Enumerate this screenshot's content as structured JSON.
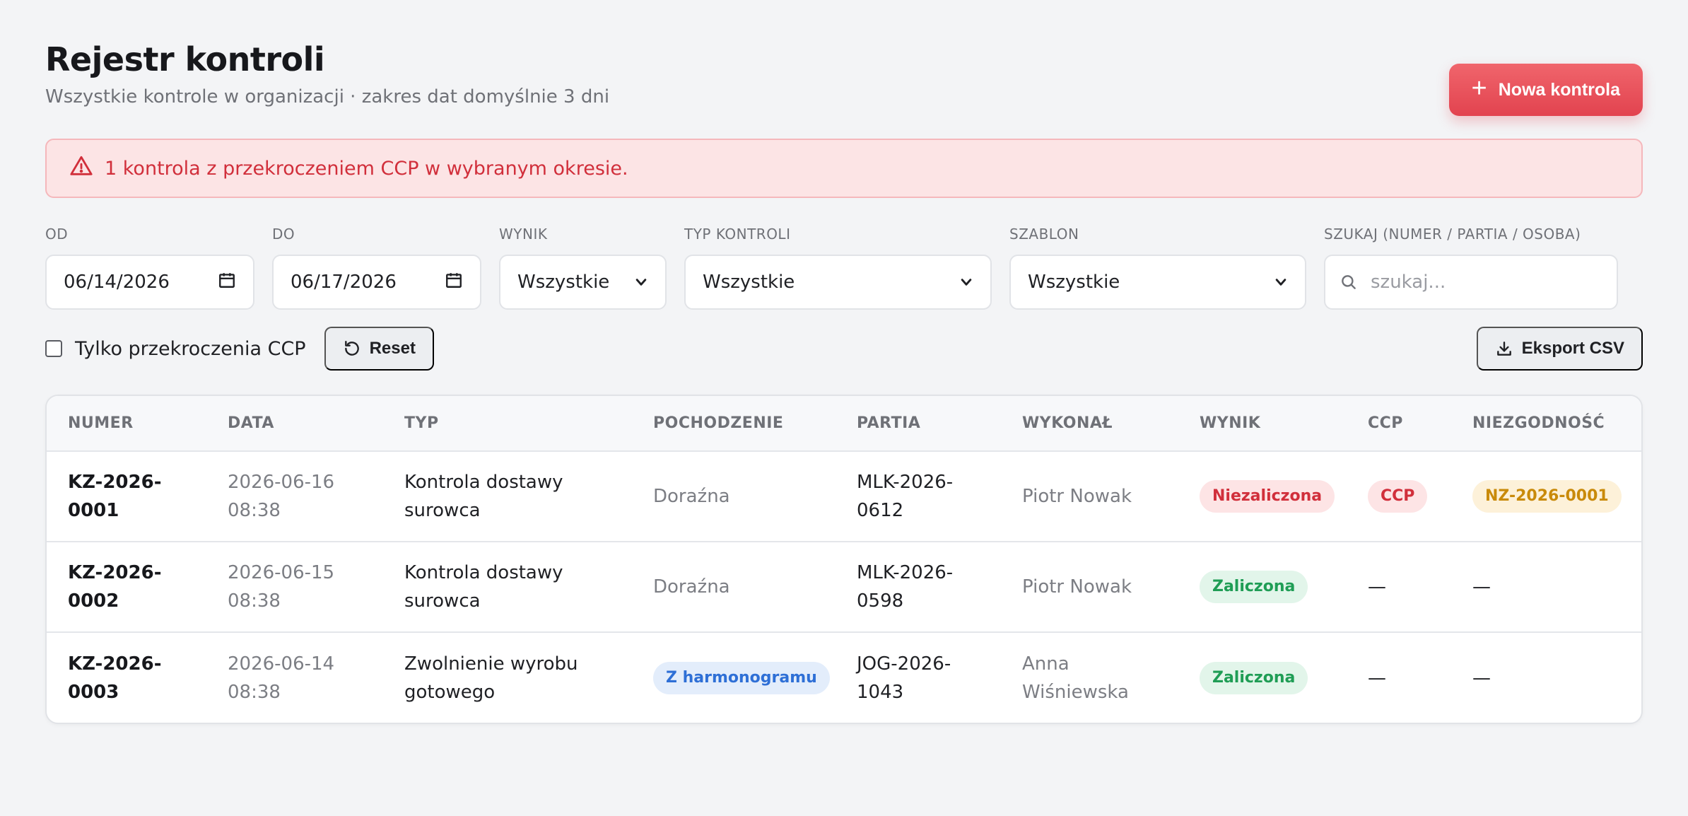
{
  "header": {
    "title": "Rejestr kontroli",
    "subtitle": "Wszystkie kontrole w organizacji · zakres dat domyślnie 3 dni",
    "new_button": "Nowa kontrola"
  },
  "alert": {
    "text": "1 kontrola z przekroczeniem CCP w wybranym okresie."
  },
  "filters": {
    "from": {
      "label": "OD",
      "value": "06/14/2026"
    },
    "to": {
      "label": "DO",
      "value": "06/17/2026"
    },
    "result": {
      "label": "WYNIK",
      "value": "Wszystkie"
    },
    "type": {
      "label": "TYP KONTROLI",
      "value": "Wszystkie"
    },
    "template": {
      "label": "SZABLON",
      "value": "Wszystkie"
    },
    "search": {
      "label": "SZUKAJ (NUMER / PARTIA / OSOBA)",
      "placeholder": "szukaj..."
    }
  },
  "toolbar": {
    "ccp_only_label": "Tylko przekroczenia CCP",
    "ccp_only_checked": false,
    "reset_label": "Reset",
    "export_label": "Eksport CSV"
  },
  "table": {
    "columns": [
      "NUMER",
      "DATA",
      "TYP",
      "POCHODZENIE",
      "PARTIA",
      "WYKONAŁ",
      "WYNIK",
      "CCP",
      "NIEZGODNOŚĆ"
    ],
    "rows": [
      {
        "number": [
          "KZ-2026-",
          "0001"
        ],
        "date": [
          "2026-06-16",
          "08:38"
        ],
        "type": [
          "Kontrola dostawy",
          "surowca"
        ],
        "origin": "Doraźna",
        "batch": [
          "MLK-2026-",
          "0612"
        ],
        "by": [
          "Piotr Nowak",
          ""
        ],
        "result": "Niezaliczona",
        "ccp": "CCP",
        "nc": "NZ-2026-0001"
      },
      {
        "number": [
          "KZ-2026-",
          "0002"
        ],
        "date": [
          "2026-06-15",
          "08:38"
        ],
        "type": [
          "Kontrola dostawy",
          "surowca"
        ],
        "origin": "Doraźna",
        "batch": [
          "MLK-2026-",
          "0598"
        ],
        "by": [
          "Piotr Nowak",
          ""
        ],
        "result": "Zaliczona",
        "ccp": "—",
        "nc": "—"
      },
      {
        "number": [
          "KZ-2026-",
          "0003"
        ],
        "date": [
          "2026-06-14",
          "08:38"
        ],
        "type": [
          "Zwolnienie wyrobu",
          "gotowego"
        ],
        "origin": "Z harmonogramu",
        "batch": [
          "JOG-2026-",
          "1043"
        ],
        "by": [
          "Anna",
          "Wiśniewska"
        ],
        "result": "Zaliczona",
        "ccp": "—",
        "nc": "—"
      }
    ]
  }
}
